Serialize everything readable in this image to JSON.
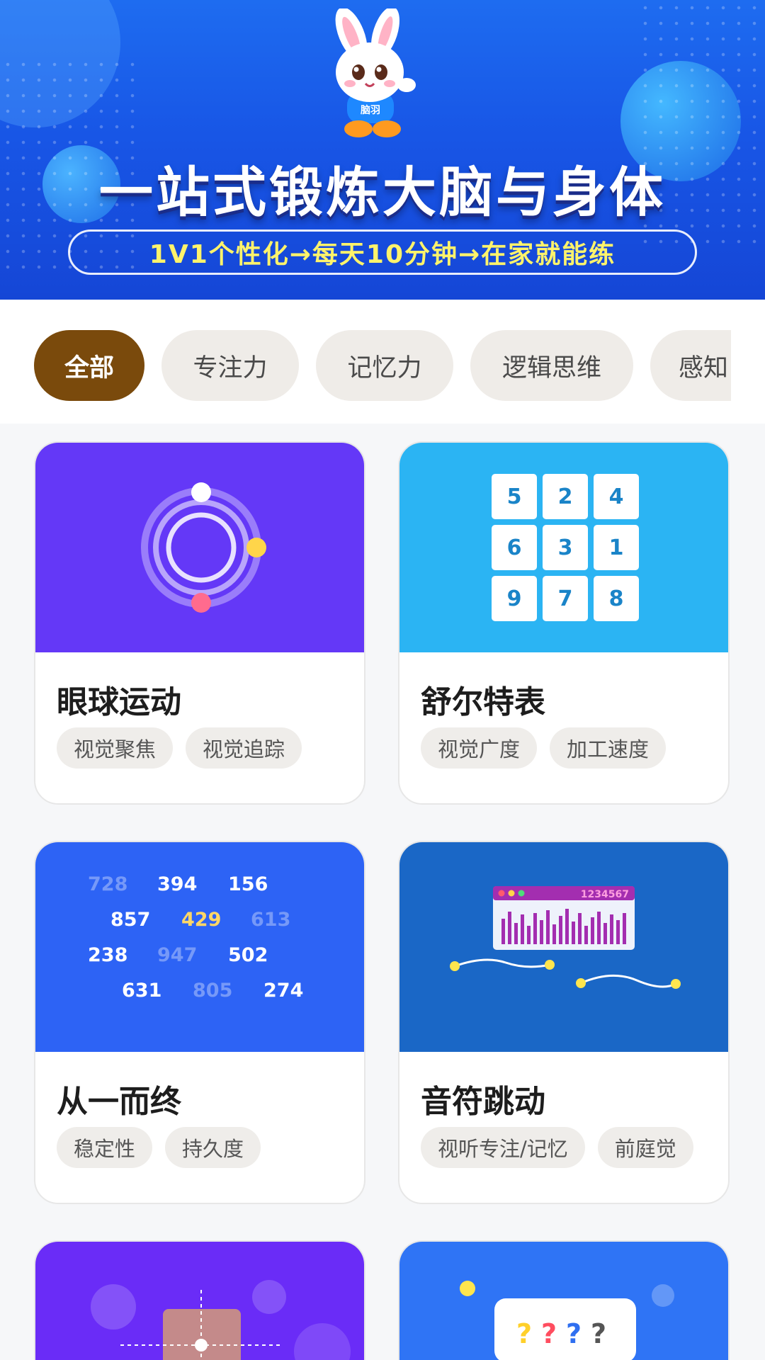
{
  "banner": {
    "headline": "一站式锻炼大脑与身体",
    "slogan": "1V1个性化→每天10分钟→在家就能练",
    "mascot_shirt_text": "脑羽",
    "colors": {
      "bg": "#1856e6",
      "slogan_text": "#fff36b"
    }
  },
  "tabs": [
    {
      "label": "全部",
      "active": true
    },
    {
      "label": "专注力",
      "active": false
    },
    {
      "label": "记忆力",
      "active": false
    },
    {
      "label": "逻辑思维",
      "active": false
    },
    {
      "label": "感知",
      "active": false
    }
  ],
  "cards": [
    {
      "title": "眼球运动",
      "tags": [
        "视觉聚焦",
        "视觉追踪"
      ],
      "thumb_color": "#6438f7",
      "icon": "orbit-icon"
    },
    {
      "title": "舒尔特表",
      "tags": [
        "视觉广度",
        "加工速度"
      ],
      "thumb_color": "#2bb4f3",
      "icon": "number-grid",
      "grid_numbers": [
        "5",
        "2",
        "4",
        "6",
        "3",
        "1",
        "9",
        "7",
        "8"
      ]
    },
    {
      "title": "从一而终",
      "tags": [
        "稳定性",
        "持久度"
      ],
      "thumb_color": "#2d63f5",
      "icon": "number-scatter",
      "scatter_numbers": [
        "728",
        "394",
        "156",
        "857",
        "429",
        "613",
        "238",
        "947",
        "502",
        "631",
        "805",
        "274"
      ]
    },
    {
      "title": "音符跳动",
      "tags": [
        "视听专注/记忆",
        "前庭觉"
      ],
      "thumb_color": "#1a67c6",
      "icon": "music-bars-icon",
      "window_text": "1234567"
    },
    {
      "title": "",
      "tags": [],
      "thumb_color": "#6a2cf7",
      "icon": "crosshair-block-icon"
    },
    {
      "title": "",
      "tags": [],
      "thumb_color": "#2f74f5",
      "icon": "question-bubble-icon",
      "question_marks": [
        "?",
        "?",
        "?",
        "?"
      ]
    }
  ]
}
